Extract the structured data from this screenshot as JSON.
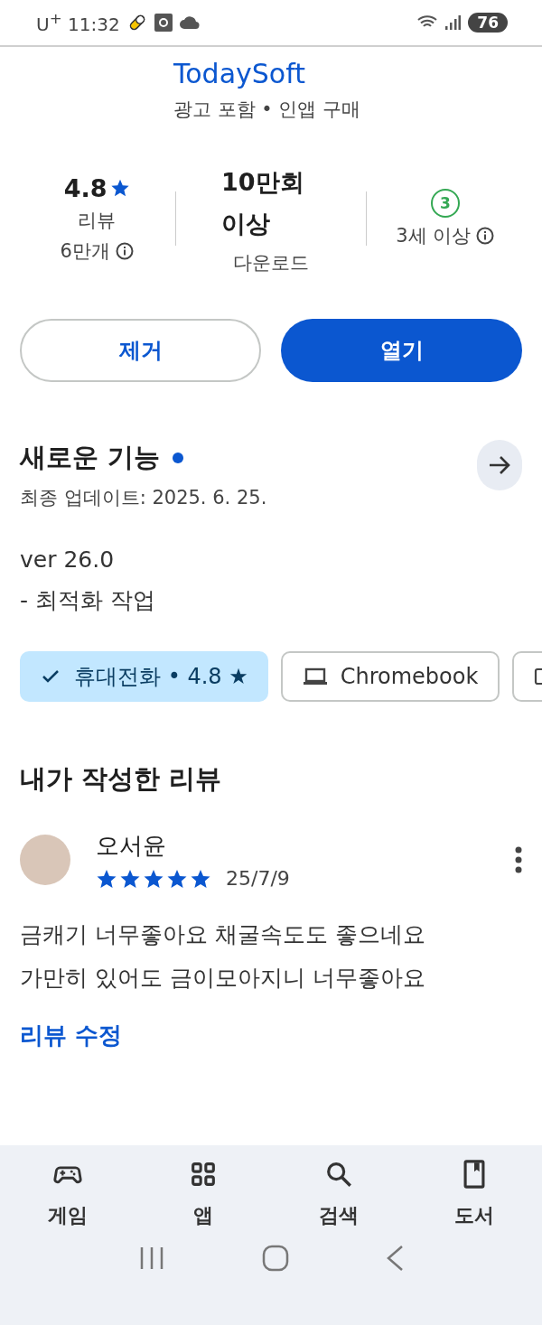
{
  "status_bar": {
    "carrier_time": "U$^{+}$ 11:32",
    "battery": "76"
  },
  "app": {
    "developer": "TodaySoft",
    "subtitle": "광고 포함 • 인앱 구매"
  },
  "stats": [
    {
      "kind": "rating",
      "value": "4.8",
      "label": "리뷰",
      "sublabel": "6만개"
    },
    {
      "kind": "downloads",
      "value": "10만회 이상",
      "label": "다운로드"
    },
    {
      "kind": "age",
      "badge": "3",
      "label": "3세 이상"
    }
  ],
  "actions": [
    {
      "label": "제거",
      "kind": "outline"
    },
    {
      "label": "열기",
      "kind": "filled"
    }
  ],
  "whats_new": {
    "title": "새로운 기능",
    "has_new": true,
    "updated": "최종 업데이트: 2025. 6. 25.",
    "lines": [
      "ver 26.0",
      "- 최적화 작업"
    ]
  },
  "devices": [
    {
      "kind": "phone",
      "label": "휴대전화 • 4.8 ★",
      "selected": true
    },
    {
      "kind": "laptop",
      "label": "Chromebook",
      "selected": false
    },
    {
      "kind": "tablet",
      "selected": false
    }
  ],
  "my_review": {
    "heading": "내가 작성한 리뷰",
    "author": "오서윤",
    "stars": 5,
    "date": "25/7/9",
    "text": [
      "금캐기 너무좋아요 채굴속도도 좋으네요",
      "가만히 있어도 금이모아지니 너무좋아요"
    ],
    "edit": "리뷰 수정"
  },
  "bottom_nav": [
    {
      "kind": "games",
      "label": "게임"
    },
    {
      "kind": "apps",
      "label": "앱"
    },
    {
      "kind": "search",
      "label": "검색"
    },
    {
      "kind": "books",
      "label": "도서"
    }
  ]
}
